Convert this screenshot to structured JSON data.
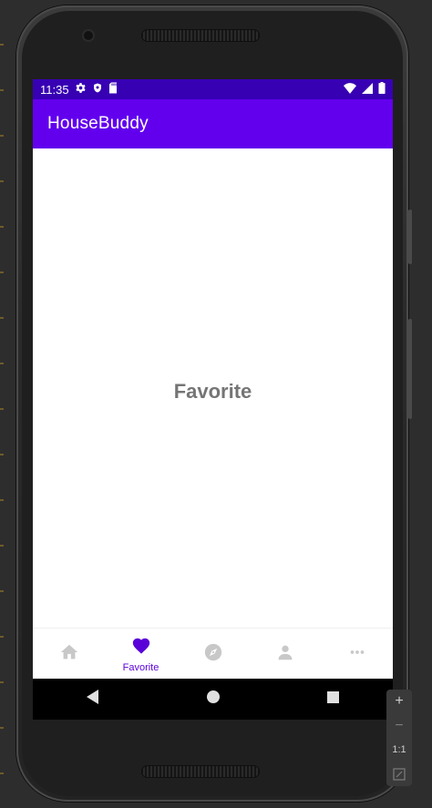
{
  "status_bar": {
    "time": "11:35",
    "icons_left": [
      "gear-icon",
      "shield-icon",
      "sd-card-icon"
    ],
    "icons_right": [
      "wifi-icon",
      "signal-icon",
      "battery-icon"
    ]
  },
  "app_bar": {
    "title": "HouseBuddy"
  },
  "content": {
    "label": "Favorite"
  },
  "bottom_nav": {
    "items": [
      {
        "icon": "home-icon",
        "label": ""
      },
      {
        "icon": "heart-icon",
        "label": "Favorite",
        "selected": true
      },
      {
        "icon": "compass-icon",
        "label": ""
      },
      {
        "icon": "person-icon",
        "label": ""
      },
      {
        "icon": "more-horizontal-icon",
        "label": ""
      }
    ]
  },
  "system_nav": {
    "items": [
      "back-icon",
      "home-circle-icon",
      "recents-square-icon"
    ]
  },
  "side_toolbar": {
    "zoom_in": "+",
    "zoom_out": "−",
    "actual_size": "1:1",
    "fit_icon": "fit-screen-icon"
  },
  "colors": {
    "primary": "#6200ee",
    "primary_dark": "#3700b3",
    "selected_nav": "#5a00d8",
    "unselected_nav": "#c8c8c8",
    "content_text": "#757575"
  }
}
